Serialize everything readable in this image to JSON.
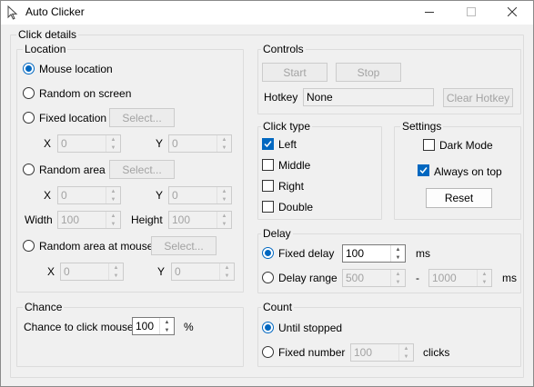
{
  "window": {
    "title": "Auto Clicker",
    "minimize_icon": "minimize-icon",
    "maximize_icon": "maximize-icon",
    "close_icon": "close-icon"
  },
  "click_details": {
    "legend": "Click details",
    "location": {
      "legend": "Location",
      "mouse_location": "Mouse location",
      "random_on_screen": "Random on screen",
      "fixed_location": "Fixed location",
      "select_label": "Select...",
      "x_label": "X",
      "y_label": "Y",
      "fixed_x": "0",
      "fixed_y": "0",
      "random_area": "Random area",
      "area_x": "0",
      "area_y": "0",
      "width_label": "Width",
      "height_label": "Height",
      "area_width": "100",
      "area_height": "100",
      "random_area_at_mouse": "Random area at mouse",
      "mouse_x": "0",
      "mouse_y": "0",
      "selected": "Mouse location"
    },
    "controls": {
      "legend": "Controls",
      "start": "Start",
      "stop": "Stop",
      "hotkey_label": "Hotkey",
      "hotkey_value": "None",
      "clear_hotkey": "Clear Hotkey"
    },
    "click_type": {
      "legend": "Click type",
      "left": "Left",
      "middle": "Middle",
      "right": "Right",
      "double": "Double",
      "checked": [
        "Left"
      ]
    },
    "settings": {
      "legend": "Settings",
      "dark_mode": "Dark Mode",
      "dark_mode_checked": false,
      "always_on_top": "Always on top",
      "always_on_top_checked": true,
      "reset": "Reset"
    },
    "chance": {
      "legend": "Chance",
      "label": "Chance to click mouse",
      "value": "100",
      "unit": "%"
    },
    "delay": {
      "legend": "Delay",
      "fixed_delay": "Fixed delay",
      "fixed_value": "100",
      "ms": "ms",
      "delay_range": "Delay range",
      "range_min": "500",
      "dash": "-",
      "range_max": "1000",
      "selected": "Fixed delay"
    },
    "count": {
      "legend": "Count",
      "until_stopped": "Until stopped",
      "fixed_number": "Fixed number",
      "fixed_value": "100",
      "clicks": "clicks",
      "selected": "Until stopped"
    }
  },
  "colors": {
    "accent": "#0067c0",
    "window_bg": "#f0f0f0",
    "titlebar_bg": "#ffffff"
  }
}
